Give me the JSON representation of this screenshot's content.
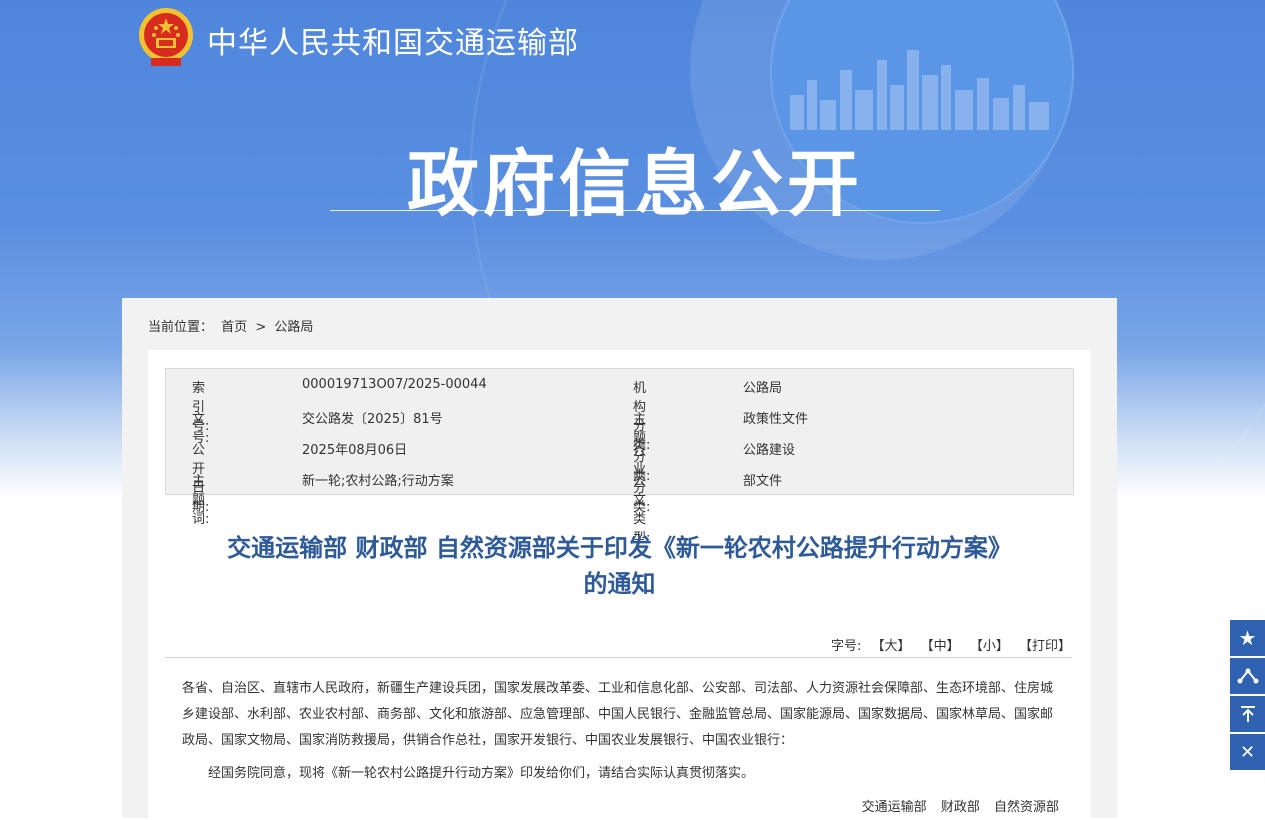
{
  "header": {
    "site_title": "中华人民共和国交通运输部",
    "hero_title": "政府信息公开"
  },
  "breadcrumb": {
    "prefix": "当前位置：",
    "home": "首页",
    "separator": ">",
    "current": "公路局"
  },
  "meta": {
    "rows": [
      {
        "label1": "索引号:",
        "value1": "000019713O07/2025-00044",
        "label2": "机构分类:",
        "value2": "公路局"
      },
      {
        "label1": "文号:",
        "value1": "交公路发〔2025〕81号",
        "label2": "主题分类:",
        "value2": "政策性文件"
      },
      {
        "label1": "公开日期:",
        "value1": "2025年08月06日",
        "label2": "行业分类:",
        "value2": "公路建设"
      },
      {
        "label1": "主题词:",
        "value1": "新一轮;农村公路;行动方案",
        "label2": "公文类型:",
        "value2": "部文件"
      }
    ]
  },
  "document": {
    "title_line1": "交通运输部 财政部 自然资源部关于印发《新一轮农村公路提升行动方案》",
    "title_line2": "的通知",
    "font_size_label": "字号:",
    "font_large": "【大】",
    "font_medium": "【中】",
    "font_small": "【小】",
    "print": "【打印】",
    "recipients": "各省、自治区、直辖市人民政府，新疆生产建设兵团，国家发展改革委、工业和信息化部、公安部、司法部、人力资源社会保障部、生态环境部、住房城乡建设部、水利部、农业农村部、商务部、文化和旅游部、应急管理部、中国人民银行、金融监管总局、国家能源局、国家数据局、国家林草局、国家邮政局、国家文物局、国家消防救援局，供销合作总社，国家开发银行、中国农业发展银行、中国农业银行：",
    "paragraph1": "经国务院同意，现将《新一轮农村公路提升行动方案》印发给你们，请结合实际认真贯彻落实。",
    "signatories": [
      "交通运输部",
      "财政部",
      "自然资源部"
    ]
  },
  "sidebar": {
    "icons": [
      "star-icon",
      "share-icon",
      "back-to-top-icon",
      "close-icon"
    ]
  },
  "colors": {
    "banner_blue": "#4f86dc",
    "title_blue": "#2f5a9a",
    "sidebar_blue": "#2f62b0"
  }
}
